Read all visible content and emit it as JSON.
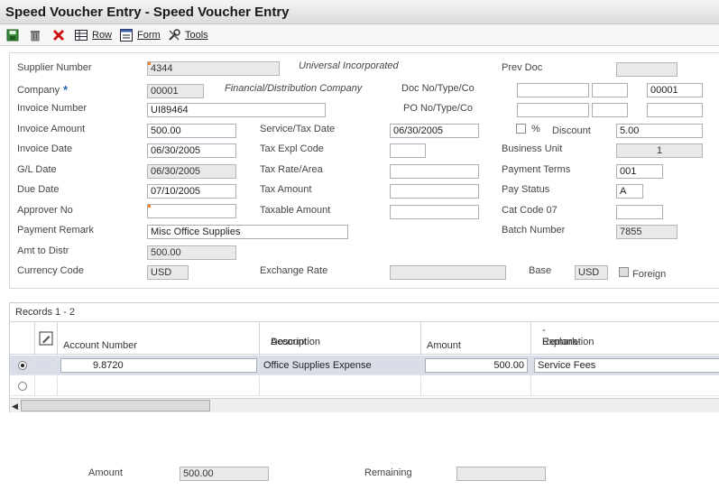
{
  "window": {
    "title": "Speed Voucher Entry - Speed Voucher Entry"
  },
  "toolbar": {
    "save_icon": "save-icon",
    "delete_icon": "trash-icon",
    "cancel_icon": "close-icon",
    "row_label": "Row",
    "form_label": "Form",
    "tools_label": "Tools"
  },
  "header": {
    "supplier_number_label": "Supplier Number",
    "supplier_number_value": "4344",
    "supplier_name": "Universal Incorporated",
    "prev_doc_label": "Prev Doc",
    "prev_doc_value": "",
    "company_label": "Company",
    "company_required": "*",
    "company_value": "00001",
    "company_name": "Financial/Distribution Company",
    "doc_label": "Doc No/Type/Co",
    "doc_no": "",
    "doc_type": "",
    "doc_co": "00001",
    "invoice_number_label": "Invoice Number",
    "invoice_number_value": "UI89464",
    "po_label": "PO No/Type/Co",
    "po_no": "",
    "po_type": "",
    "po_co": "",
    "invoice_amount_label": "Invoice Amount",
    "invoice_amount_value": "500.00",
    "service_tax_date_label": "Service/Tax Date",
    "service_tax_date_value": "06/30/2005",
    "percent_label": "%",
    "discount_label": "Discount",
    "discount_value": "5.00",
    "invoice_date_label": "Invoice Date",
    "invoice_date_value": "06/30/2005",
    "tax_expl_code_label": "Tax Expl Code",
    "tax_expl_code_value": "",
    "business_unit_label": "Business Unit",
    "business_unit_value": "1",
    "gl_date_label": "G/L Date",
    "gl_date_value": "06/30/2005",
    "tax_rate_area_label": "Tax Rate/Area",
    "tax_rate_area_value": "",
    "payment_terms_label": "Payment Terms",
    "payment_terms_value": "001",
    "due_date_label": "Due Date",
    "due_date_value": "07/10/2005",
    "tax_amount_label": "Tax Amount",
    "tax_amount_value": "",
    "pay_status_label": "Pay Status",
    "pay_status_value": "A",
    "approver_no_label": "Approver No",
    "approver_no_value": "",
    "taxable_amount_label": "Taxable Amount",
    "taxable_amount_value": "",
    "cat_code_label": "Cat Code 07",
    "cat_code_value": "",
    "payment_remark_label": "Payment Remark",
    "payment_remark_value": "Misc Office Supplies",
    "batch_number_label": "Batch Number",
    "batch_number_value": "7855",
    "amt_to_distr_label": "Amt to Distr",
    "amt_to_distr_value": "500.00",
    "currency_code_label": "Currency Code",
    "currency_code_value": "USD",
    "exchange_rate_label": "Exchange Rate",
    "exchange_rate_value": "",
    "base_label": "Base",
    "base_value": "USD",
    "foreign_label": "Foreign"
  },
  "grid": {
    "records_label": "Records 1 - 2",
    "columns": {
      "account_number": "Account Number",
      "account_description_1": "Account",
      "account_description_2": "Description",
      "amount": "Amount",
      "explanation_1": "Explanation",
      "explanation_2": "-Remark-"
    },
    "rows": [
      {
        "account_number": "9.8720",
        "description": "Office Supplies Expense",
        "amount": "500.00",
        "explanation": "Service Fees"
      },
      {
        "account_number": "",
        "description": "",
        "amount": "",
        "explanation": ""
      }
    ]
  },
  "footer": {
    "amount_label": "Amount",
    "amount_value": "500.00",
    "remaining_label": "Remaining",
    "remaining_value": ""
  },
  "colors": {
    "required_marker": "#2a5fb0",
    "highlight_marker": "#f08020",
    "selected_row": "#d9dde8"
  }
}
